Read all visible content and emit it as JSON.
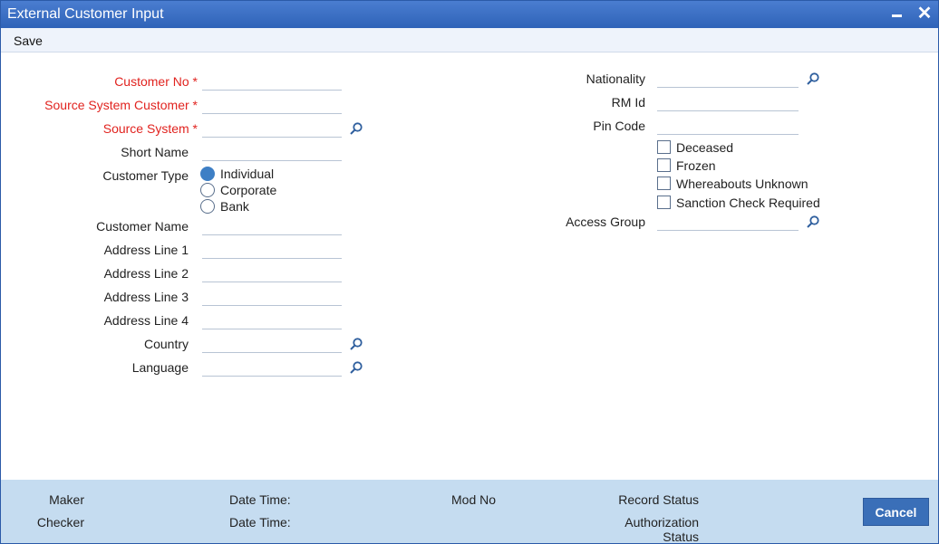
{
  "window": {
    "title": "External Customer Input",
    "minimize_glyph": "",
    "close_glyph": "✕"
  },
  "menu": {
    "save_label": "Save"
  },
  "left": {
    "customer_no": {
      "label": "Customer No *",
      "value": ""
    },
    "source_system_customer": {
      "label": "Source System Customer *",
      "value": ""
    },
    "source_system": {
      "label": "Source System *",
      "value": ""
    },
    "short_name": {
      "label": "Short Name",
      "value": ""
    },
    "customer_type": {
      "label": "Customer Type",
      "options": [
        "Individual",
        "Corporate",
        "Bank"
      ],
      "selected": "Individual"
    },
    "customer_name": {
      "label": "Customer Name",
      "value": ""
    },
    "address_line_1": {
      "label": "Address Line 1",
      "value": ""
    },
    "address_line_2": {
      "label": "Address Line 2",
      "value": ""
    },
    "address_line_3": {
      "label": "Address Line 3",
      "value": ""
    },
    "address_line_4": {
      "label": "Address Line 4",
      "value": ""
    },
    "country": {
      "label": "Country",
      "value": ""
    },
    "language": {
      "label": "Language",
      "value": ""
    }
  },
  "right": {
    "nationality": {
      "label": "Nationality",
      "value": ""
    },
    "rm_id": {
      "label": "RM Id",
      "value": ""
    },
    "pin_code": {
      "label": "Pin Code",
      "value": ""
    },
    "checkboxes": [
      {
        "label": "Deceased",
        "checked": false
      },
      {
        "label": "Frozen",
        "checked": false
      },
      {
        "label": "Whereabouts Unknown",
        "checked": false
      },
      {
        "label": "Sanction Check Required",
        "checked": false
      }
    ],
    "access_group": {
      "label": "Access Group",
      "value": ""
    }
  },
  "footer": {
    "maker": "Maker",
    "checker": "Checker",
    "date_time_1": "Date Time:",
    "date_time_2": "Date Time:",
    "mod_no": "Mod No",
    "record_status": "Record Status",
    "authorization_status_line1": "Authorization",
    "authorization_status_line2": "Status",
    "cancel_label": "Cancel"
  },
  "colors": {
    "title_bar": "#2f63b8",
    "required_label": "#e1231f",
    "footer_bg": "#c5dcf0",
    "cancel_button": "#3a6fb8",
    "radio_selected": "#3e7fc5"
  },
  "icons": {
    "lookup": "magnifier-icon",
    "close": "close-icon",
    "minimize": "minimize-icon"
  }
}
